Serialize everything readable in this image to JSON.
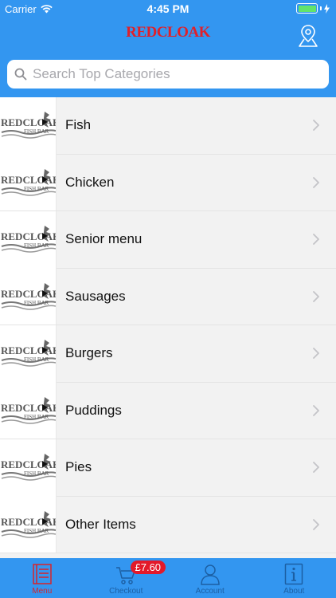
{
  "status_bar": {
    "carrier": "Carrier",
    "time": "4:45 PM"
  },
  "nav": {
    "brand": "REDCLOAK"
  },
  "search": {
    "placeholder": "Search Top Categories"
  },
  "thumbnail": {
    "logo_text": "REDCLOAK",
    "logo_subtext": "FISH BAR"
  },
  "categories": [
    {
      "label": "Fish"
    },
    {
      "label": "Chicken"
    },
    {
      "label": "Senior menu"
    },
    {
      "label": "Sausages"
    },
    {
      "label": "Burgers"
    },
    {
      "label": "Puddings"
    },
    {
      "label": "Pies"
    },
    {
      "label": "Other Items"
    }
  ],
  "tabs": {
    "menu": "Menu",
    "checkout": "Checkout",
    "checkout_badge": "£7.60",
    "account": "Account",
    "about": "About"
  },
  "colors": {
    "header": "#3396f0",
    "brand": "#e0202a",
    "badge": "#e3192a",
    "active_tab": "#d8232a"
  }
}
